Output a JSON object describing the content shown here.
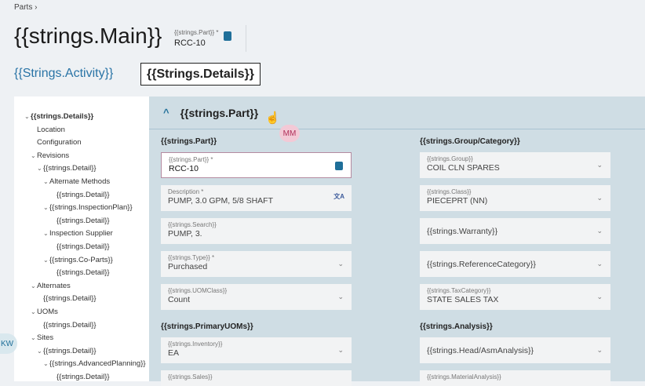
{
  "breadcrumb": {
    "item": "Parts",
    "sep": "›"
  },
  "header": {
    "title": "{{strings.Main}}",
    "part_label": "{{strings.Part}} *",
    "part_value": "RCC-10"
  },
  "tabs": [
    {
      "label": "{{Strings.Activity}}"
    },
    {
      "label": "{{Strings.Details}}",
      "active": true
    }
  ],
  "tree": [
    {
      "label": "{{strings.Details}}",
      "level": 0,
      "chev": true,
      "bold": true
    },
    {
      "label": "Location",
      "level": 1,
      "chev": false
    },
    {
      "label": "Configuration",
      "level": 1,
      "chev": false
    },
    {
      "label": "Revisions",
      "level": 1,
      "chev": true
    },
    {
      "label": "{{strings.Detail}}",
      "level": 2,
      "chev": true
    },
    {
      "label": "Alternate Methods",
      "level": 3,
      "chev": true
    },
    {
      "label": "{{strings.Detail}}",
      "level": 4,
      "chev": false
    },
    {
      "label": "{{strings.InspectionPlan}}",
      "level": 3,
      "chev": true
    },
    {
      "label": "{{strings.Detail}}",
      "level": 4,
      "chev": false
    },
    {
      "label": "Inspection Supplier",
      "level": 3,
      "chev": true
    },
    {
      "label": "{{strings.Detail}}",
      "level": 4,
      "chev": false
    },
    {
      "label": "{{strings.Co-Parts}}",
      "level": 3,
      "chev": true
    },
    {
      "label": "{{strings.Detail}}",
      "level": 4,
      "chev": false
    },
    {
      "label": "Alternates",
      "level": 1,
      "chev": true
    },
    {
      "label": "{{strings.Detail}}",
      "level": 2,
      "chev": false
    },
    {
      "label": "UOMs",
      "level": 1,
      "chev": true
    },
    {
      "label": "{{strings.Detail}}",
      "level": 2,
      "chev": false
    },
    {
      "label": "Sites",
      "level": 1,
      "chev": true
    },
    {
      "label": "{{strings.Detail}}",
      "level": 2,
      "chev": true
    },
    {
      "label": "{{strings.AdvancedPlanning}}",
      "level": 3,
      "chev": true
    },
    {
      "label": "{{strings.Detail}}",
      "level": 4,
      "chev": false
    }
  ],
  "section": {
    "title": "{{strings.Part}}"
  },
  "presence": {
    "mm": "MM",
    "kw": "KW"
  },
  "groups": {
    "left1": "{{strings.Part}}",
    "right1": "{{strings.Group/Category}}",
    "left2": "{{strings.PrimaryUOMs}}",
    "right2": "{{strings.Analysis}}"
  },
  "fields": [
    {
      "col": 0,
      "row": 0,
      "label": "{{strings.Part}} *",
      "value": "RCC-10",
      "icon": "search",
      "active": true
    },
    {
      "col": 0,
      "row": 1,
      "label": "Description *",
      "value": "PUMP, 3.0 GPM, 5/8 SHAFT",
      "icon": "translate"
    },
    {
      "col": 0,
      "row": 2,
      "label": "{{strings.Search}}",
      "value": "PUMP, 3."
    },
    {
      "col": 0,
      "row": 3,
      "label": "{{strings.Type}} *",
      "value": "Purchased",
      "icon": "chevron"
    },
    {
      "col": 0,
      "row": 4,
      "label": "{{strings.UOMClass}}",
      "value": "Count",
      "icon": "chevron"
    },
    {
      "col": 0,
      "row": 5,
      "label": "{{strings.Inventory}}",
      "value": "EA",
      "icon": "chevron"
    },
    {
      "col": 0,
      "row": 6,
      "label": "{{strings.Sales}}",
      "value": ""
    },
    {
      "col": 1,
      "row": 0,
      "label": "{{strings.Group}}",
      "value": "COIL CLN SPARES",
      "icon": "chevron"
    },
    {
      "col": 1,
      "row": 1,
      "label": "{{strings.Class}}",
      "value": "PIECEPRT (NN)",
      "icon": "chevron"
    },
    {
      "col": 1,
      "row": 2,
      "label": "",
      "value": "{{strings.Warranty}}",
      "icon": "chevron"
    },
    {
      "col": 1,
      "row": 3,
      "label": "",
      "value": "{{strings.ReferenceCategory}}",
      "icon": "chevron"
    },
    {
      "col": 1,
      "row": 4,
      "label": "{{strings.TaxCategory}}",
      "value": "STATE SALES TAX",
      "icon": "chevron"
    },
    {
      "col": 1,
      "row": 5,
      "label": "",
      "value": "{{strings.Head/AsmAnalysis}}",
      "icon": "chevron"
    },
    {
      "col": 1,
      "row": 6,
      "label": "{{strings.MaterialAnalysis}}",
      "value": ""
    }
  ]
}
